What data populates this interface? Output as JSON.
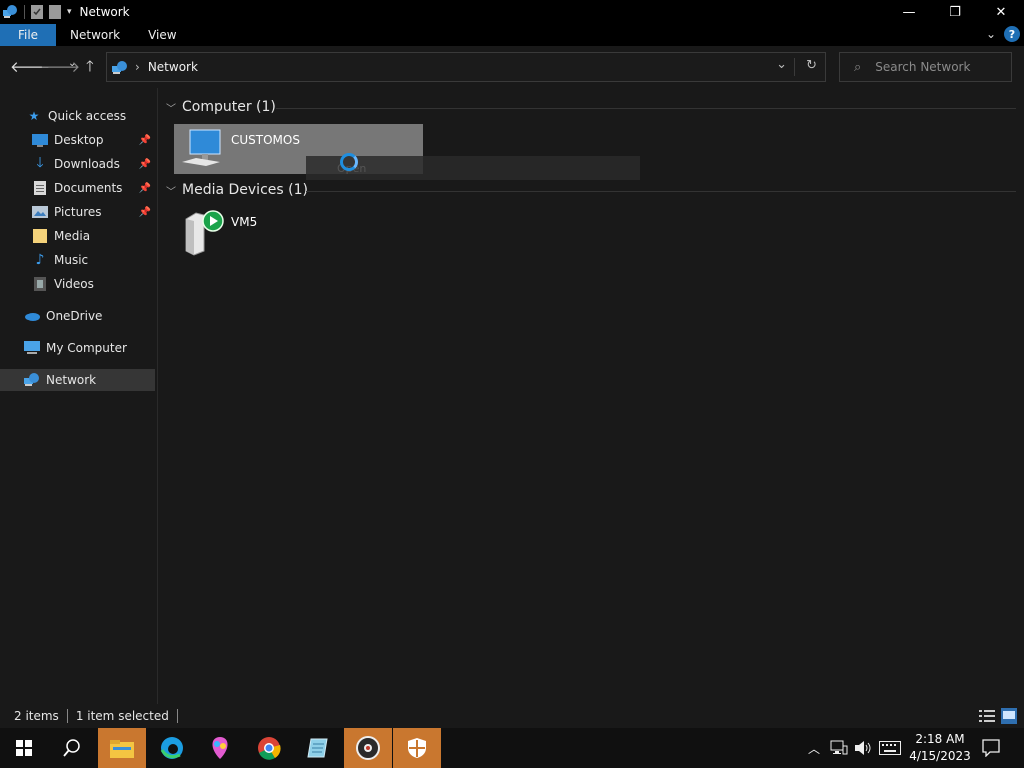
{
  "window": {
    "title": "Network",
    "min_glyph": "—",
    "restore_glyph": "❐",
    "close_glyph": "✕"
  },
  "ribbon": {
    "tabs": [
      {
        "label": "File"
      },
      {
        "label": "Network"
      },
      {
        "label": "View"
      }
    ],
    "help_glyph": "?"
  },
  "address": {
    "path": "Network",
    "separator": "›",
    "search_placeholder": "Search Network"
  },
  "sidebar": {
    "items": [
      {
        "label": "Quick access",
        "icon": "star-icon"
      },
      {
        "label": "Desktop",
        "icon": "desktop-icon",
        "pinned": true
      },
      {
        "label": "Downloads",
        "icon": "download-icon",
        "pinned": true
      },
      {
        "label": "Documents",
        "icon": "document-icon",
        "pinned": true
      },
      {
        "label": "Pictures",
        "icon": "pictures-icon",
        "pinned": true
      },
      {
        "label": "Media",
        "icon": "folder-icon"
      },
      {
        "label": "Music",
        "icon": "music-icon"
      },
      {
        "label": "Videos",
        "icon": "video-icon"
      },
      {
        "label": "OneDrive",
        "icon": "cloud-icon"
      },
      {
        "label": "My Computer",
        "icon": "computer-icon"
      },
      {
        "label": "Network",
        "icon": "network-icon",
        "selected": true
      }
    ]
  },
  "content": {
    "groups": [
      {
        "header": "Computer (1)",
        "items": [
          {
            "label": "CUSTOMOS",
            "selected": true
          }
        ]
      },
      {
        "header": "Media Devices (1)",
        "items": [
          {
            "label": "VM5"
          }
        ]
      }
    ],
    "tooltip_text": "Open"
  },
  "status": {
    "count": "2 items",
    "selected": "1 item selected"
  },
  "taskbar": {
    "time": "2:18 AM",
    "date": "4/15/2023"
  },
  "colors": {
    "accent": "#1f6fb5",
    "taskbar_active": "#c9772f",
    "selection": "#777777"
  }
}
